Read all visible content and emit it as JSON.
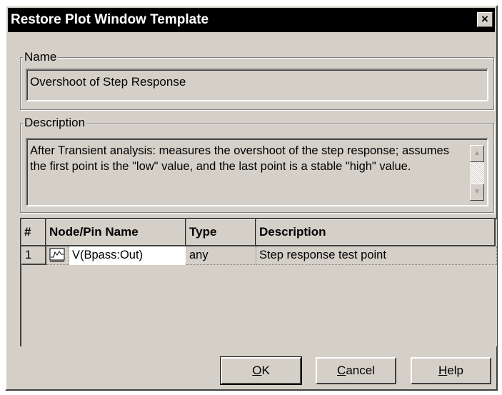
{
  "dialog": {
    "title": "Restore Plot Window Template",
    "close_glyph": "×"
  },
  "name_group": {
    "label": "Name",
    "value": "Overshoot of Step Response"
  },
  "description_group": {
    "label": "Description",
    "text": "After Transient analysis: measures the overshoot of the step response; assumes the first point is the \"low\" value, and the last point is a stable \"high\" value."
  },
  "table": {
    "columns": [
      "#",
      "Node/Pin Name",
      "Type",
      "Description"
    ],
    "rows": [
      {
        "index": "1",
        "icon": "waveform-icon",
        "node": "V(Bpass:Out)",
        "type": "any",
        "description": "Step response test point"
      }
    ]
  },
  "buttons": {
    "ok": {
      "mnemonic": "O",
      "rest": "K"
    },
    "cancel": {
      "mnemonic": "C",
      "rest": "ancel"
    },
    "help": {
      "mnemonic": "H",
      "rest": "elp"
    }
  },
  "icons": {
    "close": "close-icon",
    "scroll_up": "scroll-up-arrow-icon",
    "scroll_down": "scroll-down-arrow-icon"
  }
}
